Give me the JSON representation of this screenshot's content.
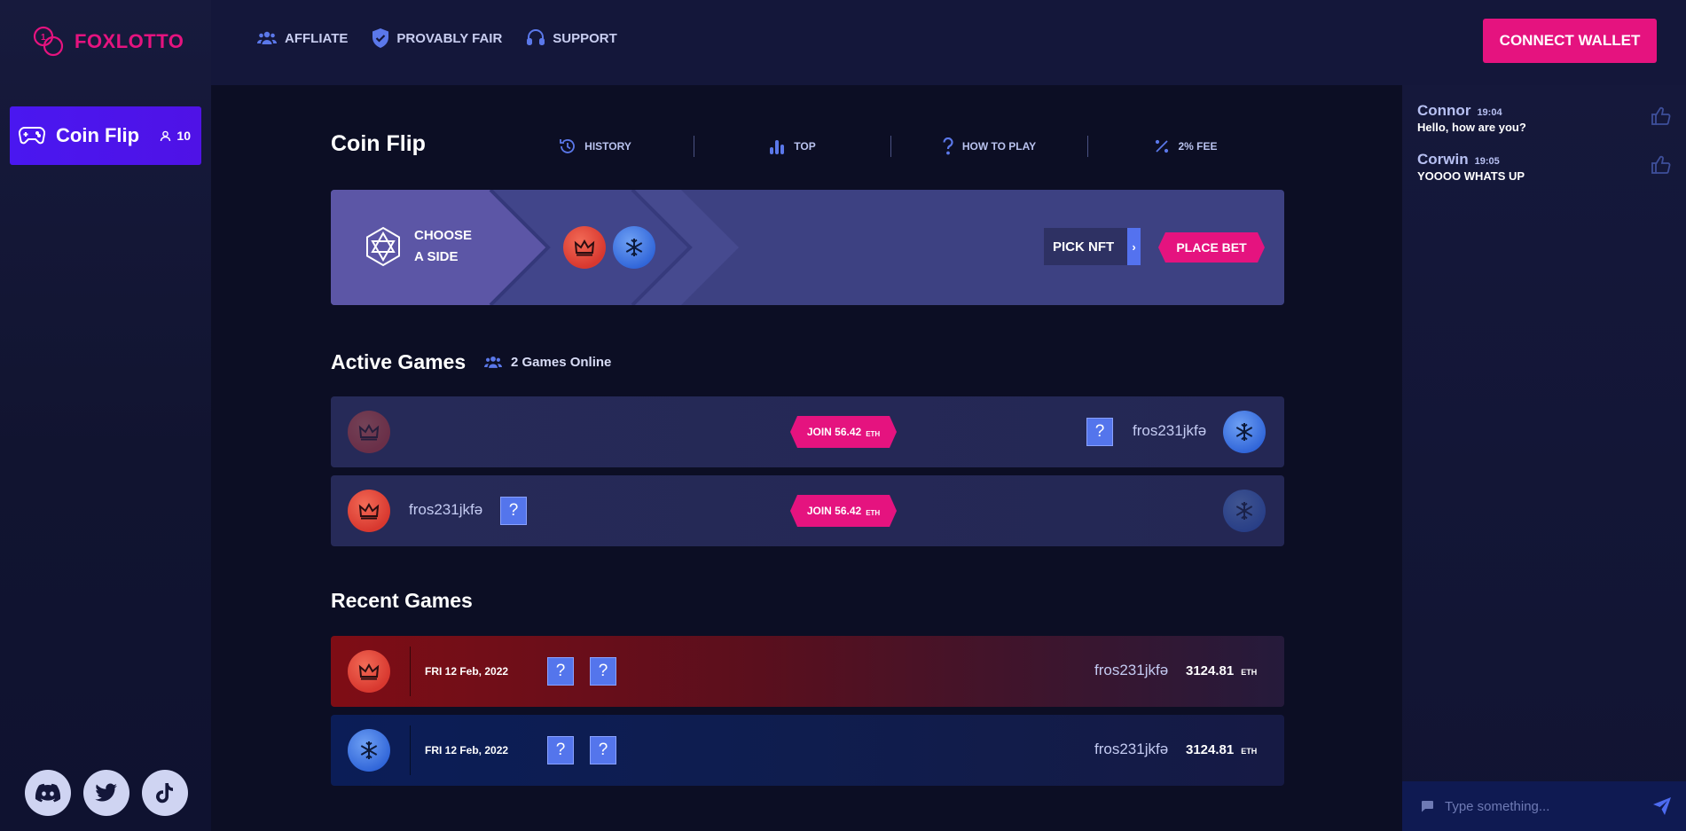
{
  "brand": {
    "name": "FOXLOTTO"
  },
  "sidebar": {
    "game_tab": {
      "label": "Coin Flip",
      "players": "10"
    },
    "socials": [
      "discord-icon",
      "twitter-icon",
      "tiktok-icon"
    ]
  },
  "nav": {
    "items": [
      {
        "label": "AFFLIATE",
        "icon": "users-icon"
      },
      {
        "label": "PROVABLY FAIR",
        "icon": "shield-check-icon"
      },
      {
        "label": "SUPPORT",
        "icon": "headset-icon"
      }
    ],
    "connect_label": "CONNECT WALLET"
  },
  "main": {
    "title": "Coin Flip",
    "tabs": [
      {
        "label": "HISTORY",
        "icon": "history-icon"
      },
      {
        "label": "TOP",
        "icon": "bar-chart-icon"
      },
      {
        "label": "HOW TO PLAY",
        "icon": "question-icon"
      },
      {
        "label": "2% FEE",
        "icon": "percent-icon"
      }
    ],
    "bet": {
      "choose_line1": "CHOOSE",
      "choose_line2": "A SIDE",
      "sides": [
        "crown-side",
        "snowflake-side"
      ],
      "pick_nft_label": "PICK NFT",
      "pick_nft_arrow": "›",
      "place_bet_label": "PLACE BET"
    },
    "active": {
      "title": "Active Games",
      "online_text": "2 Games Online",
      "games": [
        {
          "left_side": "crown",
          "left_empty": true,
          "join_label": "JOIN 56.42",
          "join_unit": "ETH",
          "right_player": "fros231jkfə",
          "right_item": "?",
          "right_side": "snowflake"
        },
        {
          "left_side": "crown",
          "left_player": "fros231jkfə",
          "left_item": "?",
          "join_label": "JOIN 56.42",
          "join_unit": "ETH",
          "right_side": "snowflake",
          "right_empty": true
        }
      ]
    },
    "recent": {
      "title": "Recent Games",
      "games": [
        {
          "side": "crown",
          "date": "FRI 12 Feb, 2022",
          "items": [
            "?",
            "?"
          ],
          "player": "fros231jkfə",
          "amount": "3124.81",
          "unit": "ETH"
        },
        {
          "side": "snowflake",
          "date": "FRI 12 Feb, 2022",
          "items": [
            "?",
            "?"
          ],
          "player": "fros231jkfə",
          "amount": "3124.81",
          "unit": "ETH"
        }
      ]
    }
  },
  "chat": {
    "messages": [
      {
        "name": "Connor",
        "time": "19:04",
        "text": "Hello, how are you?"
      },
      {
        "name": "Corwin",
        "time": "19:05",
        "text": "YOOOO WHATS UP"
      }
    ],
    "placeholder": "Type something..."
  },
  "colors": {
    "accent": "#e5137f",
    "primary": "#4a17f0",
    "crown_side": "#d8382f",
    "snowflake_side": "#2f64d8"
  }
}
